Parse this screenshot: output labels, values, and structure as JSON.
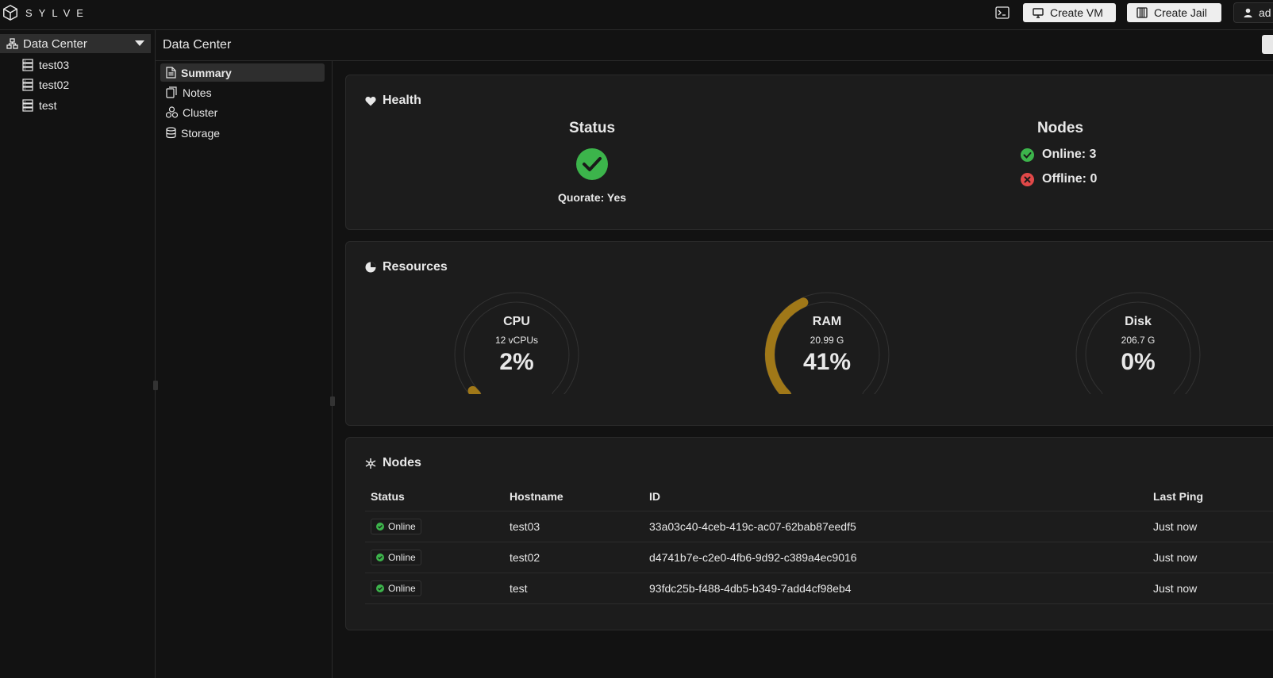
{
  "app": {
    "name": "SYLVE"
  },
  "topbar": {
    "create_vm_label": "Create VM",
    "create_jail_label": "Create Jail",
    "user_label": "ad"
  },
  "tree": {
    "root_label": "Data Center",
    "nodes": [
      "test03",
      "test02",
      "test"
    ]
  },
  "header": {
    "title": "Data Center"
  },
  "submenu": {
    "items": [
      {
        "label": "Summary",
        "icon": "document-icon",
        "active": true
      },
      {
        "label": "Notes",
        "icon": "notes-icon"
      },
      {
        "label": "Cluster",
        "icon": "cluster-icon"
      },
      {
        "label": "Storage",
        "icon": "database-icon"
      }
    ]
  },
  "health": {
    "title": "Health",
    "status_heading": "Status",
    "quorate": "Quorate: Yes",
    "nodes_heading": "Nodes",
    "online": "Online: 3",
    "offline": "Offline: 0"
  },
  "resources": {
    "title": "Resources",
    "gauges": [
      {
        "name": "CPU",
        "sub": "12 vCPUs",
        "percent": 2,
        "label": "2%"
      },
      {
        "name": "RAM",
        "sub": "20.99 G",
        "percent": 41,
        "label": "41%"
      },
      {
        "name": "Disk",
        "sub": "206.7 G",
        "percent": 0,
        "label": "0%"
      }
    ]
  },
  "nodes_table": {
    "title": "Nodes",
    "columns": [
      "Status",
      "Hostname",
      "ID",
      "Last Ping"
    ],
    "rows": [
      {
        "status": "Online",
        "hostname": "test03",
        "id": "33a03c40-4ceb-419c-ac07-62bab87eedf5",
        "last_ping": "Just now"
      },
      {
        "status": "Online",
        "hostname": "test02",
        "id": "d4741b7e-c2e0-4fb6-9d92-c389a4ec9016",
        "last_ping": "Just now"
      },
      {
        "status": "Online",
        "hostname": "test",
        "id": "93fdc25b-f488-4db5-b349-7add4cf98eb4",
        "last_ping": "Just now"
      }
    ]
  },
  "colors": {
    "accent_gauge": "#a07818",
    "ok_green": "#3cb44b",
    "error_red": "#e04848",
    "card_bg": "#1c1c1c"
  }
}
